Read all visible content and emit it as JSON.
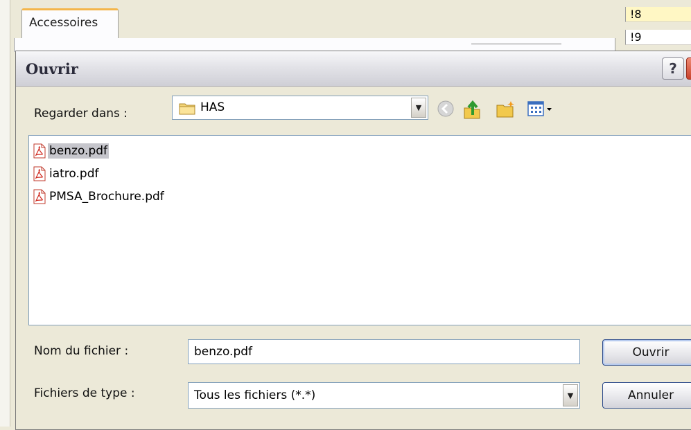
{
  "background": {
    "tab_label": "Accessoires",
    "cells": [
      "!8",
      "!9"
    ]
  },
  "dialog": {
    "title": "Ouvrir",
    "help_label": "?",
    "close_label": "x",
    "look_in_label": "Regarder dans :",
    "look_in_value": "HAS",
    "files": [
      {
        "name": "benzo.pdf",
        "selected": true,
        "icon": "pdf-file-icon"
      },
      {
        "name": "iatro.pdf",
        "selected": false,
        "icon": "pdf-file-icon"
      },
      {
        "name": "PMSA_Brochure.pdf",
        "selected": false,
        "icon": "pdf-file-icon"
      }
    ],
    "filename_label": "Nom du fichier :",
    "filename_value": "benzo.pdf",
    "filetype_label": "Fichiers de type :",
    "filetype_value": "Tous les fichiers (*.*)",
    "open_button": "Ouvrir",
    "cancel_button": "Annuler",
    "toolbar_icons": [
      "back-arrow-icon",
      "up-folder-icon",
      "new-folder-icon",
      "views-menu-icon"
    ]
  },
  "colors": {
    "dialog_bg": "#ece9d8",
    "field_border": "#7f9db9",
    "selection": "#c6c6cc",
    "tab_accent": "#f4b64a",
    "close_red": "#c9412b"
  }
}
